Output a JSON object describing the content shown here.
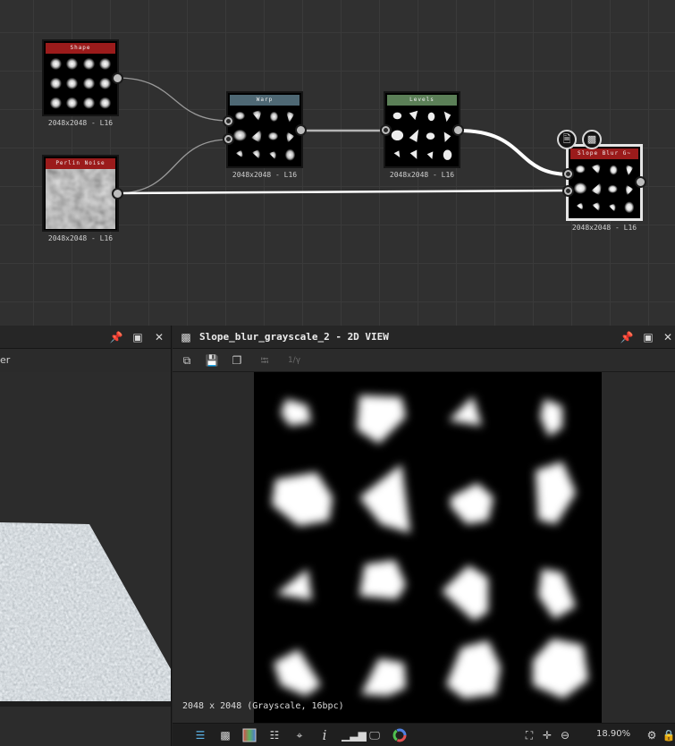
{
  "graph": {
    "nodes": {
      "shape": {
        "title": "Shape",
        "resolution": "2048x2048 - L16",
        "title_color": "#9b1b1b"
      },
      "perlin": {
        "title": "Perlin Noise",
        "resolution": "2048x2048 - L16",
        "title_color": "#9b1b1b"
      },
      "warp": {
        "title": "Warp",
        "resolution": "2048x2048 - L16",
        "title_color": "#4e6874"
      },
      "levels": {
        "title": "Levels",
        "resolution": "2048x2048 - L16",
        "title_color": "#5b7f57"
      },
      "slope_blur": {
        "title": "Slope Blur G~",
        "resolution": "2048x2048 - L16",
        "title_color": "#9b1b1b"
      }
    },
    "node_icons": [
      "document-icon",
      "checker-icon"
    ]
  },
  "left_panel": {
    "label": "er",
    "icons": [
      "pin-icon",
      "maximize-icon",
      "close-icon"
    ]
  },
  "view2d": {
    "title": "Slope_blur_grayscale_2 - 2D VIEW",
    "toolbar_icons": [
      "copy-view-icon",
      "save-icon",
      "copy-icon",
      "share-icon",
      "gamma-icon"
    ],
    "gamma_label": "1/γ",
    "info": "2048 x 2048 (Grayscale, 16bpc)",
    "zoom": "18.90%",
    "status_icons": [
      "layers-icon",
      "checker-icon",
      "gradient-icon",
      "grid-icon",
      "pivot-icon",
      "info-icon",
      "histogram-icon",
      "display-icon",
      "color-wheel-icon",
      "fit-icon",
      "move-icon",
      "zoom-out-icon",
      "settings-icon",
      "lock-icon"
    ]
  }
}
